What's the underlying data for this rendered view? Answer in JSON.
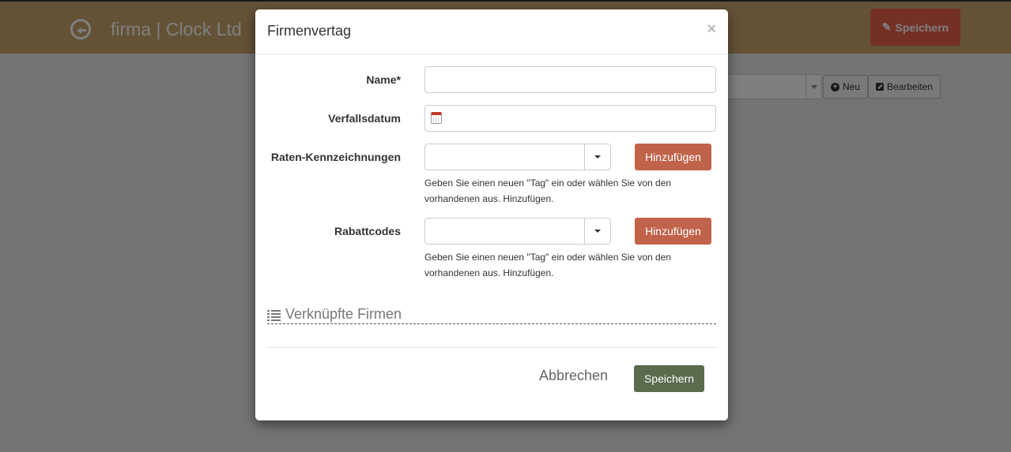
{
  "page": {
    "title": "firma | Clock Ltd",
    "save_label": "Speichern",
    "neu_label": "Neu",
    "bearbeiten_label": "Bearbeiten"
  },
  "modal": {
    "title": "Firmenvertag",
    "close_glyph": "×",
    "fields": {
      "name_label": "Name*",
      "name_value": "",
      "expiry_label": "Verfallsdatum",
      "expiry_value": "",
      "rate_tags_label": "Raten-Kennzeichnungen",
      "rate_tags_value": "",
      "rate_tags_add": "Hinzufügen",
      "rate_tags_help": "Geben Sie einen neuen \"Tag\" ein oder wählen Sie von den vorhandenen aus. Hinzufügen.",
      "discount_label": "Rabattcodes",
      "discount_value": "",
      "discount_add": "Hinzufügen",
      "discount_help": "Geben Sie einen neuen \"Tag\" ein oder wählen Sie von den vorhandenen aus. Hinzufügen."
    },
    "linked_section": "Verknüpfte Firmen",
    "cancel_label": "Abbrechen",
    "save_label": "Speichern"
  },
  "colors": {
    "topbar": "#c9a56e",
    "add_button": "#c0634a",
    "save_button": "#5a6b4e",
    "top_save": "#e8604a"
  }
}
